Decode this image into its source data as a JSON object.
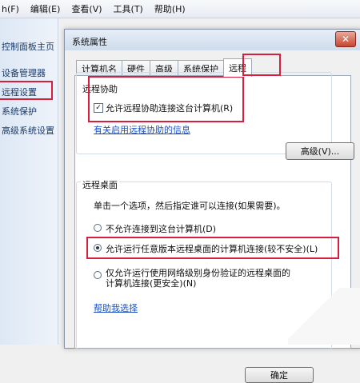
{
  "menubar": {
    "items": [
      "h(F)",
      "编辑(E)",
      "查看(V)",
      "工具(T)",
      "帮助(H)"
    ]
  },
  "left_pane": {
    "home": "控制面板主页",
    "device_manager": "设备管理器",
    "remote_settings": "远程设置",
    "system_protection": "系统保护",
    "advanced_settings": "高级系统设置"
  },
  "dialog": {
    "title": "系统属性",
    "close": "✕",
    "tabs": [
      "计算机名",
      "硬件",
      "高级",
      "系统保护",
      "远程"
    ],
    "active_tab": "远程",
    "remote_assistance": {
      "group_title": "远程协助",
      "checkbox_label": "允许远程协助连接这台计算机(R)",
      "checkbox_checked": true,
      "info_link": "有关启用远程协助的信息",
      "advanced_button": "高级(V)..."
    },
    "remote_desktop": {
      "group_title": "远程桌面",
      "description": "单击一个选项，然后指定谁可以连接(如果需要)。",
      "options": [
        "不允许连接到这台计算机(D)",
        "允许运行任意版本远程桌面的计算机连接(较不安全)(L)",
        "仅允许运行使用网络级别身份验证的远程桌面的计算机连接(更安全)(N)"
      ],
      "selected_index": 1,
      "help_link": "帮助我选择"
    },
    "ok_button": "确定"
  },
  "colors": {
    "highlight_box": "#d81e3c",
    "link": "#1b50c7"
  }
}
